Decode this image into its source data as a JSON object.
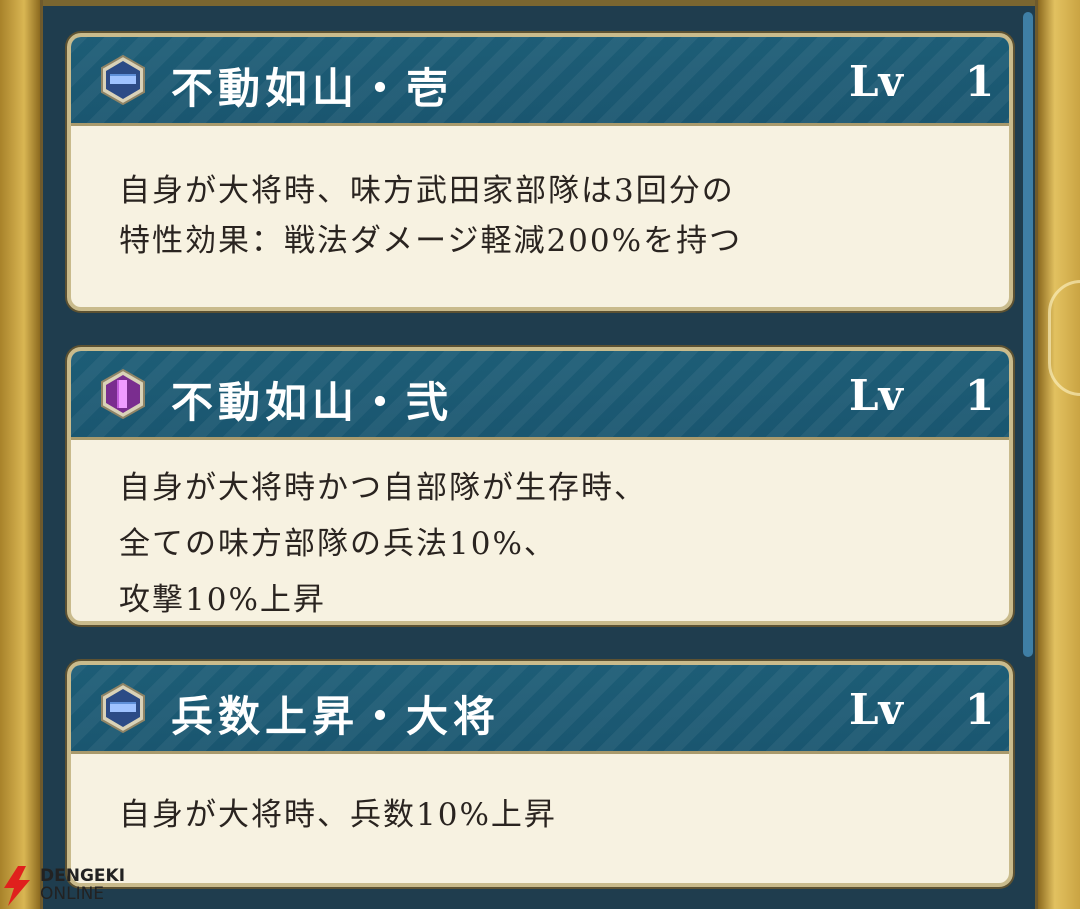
{
  "skills": [
    {
      "name": "不動如山・壱",
      "icon": "blue-hexagon-icon",
      "icon_color": "#4a7fc8",
      "lv_label": "Lv",
      "lv_value": "1",
      "lines": [
        "自身が大将時、味方武田家部隊は3回分の",
        "特性効果：戦法ダメージ軽減200%を持つ"
      ]
    },
    {
      "name": "不動如山・弐",
      "icon": "purple-hexagon-icon",
      "icon_color": "#b04bc7",
      "lv_label": "Lv",
      "lv_value": "1",
      "lines": [
        "自身が大将時かつ自部隊が生存時、",
        "全ての味方部隊の兵法10%、",
        "攻撃10%上昇"
      ]
    },
    {
      "name": "兵数上昇・大将",
      "icon": "blue-hexagon-icon",
      "icon_color": "#4a7fc8",
      "lv_label": "Lv",
      "lv_value": "1",
      "lines": [
        "自身が大将時、兵数10%上昇"
      ]
    }
  ],
  "watermark": {
    "line1": "DENGEKI",
    "line2": "ONLINE"
  },
  "colors": {
    "header_bg": "#1a5670",
    "card_bg": "#f7f2e1",
    "panel_bg": "#1f3d4e",
    "accent_gold": "#c9a23e",
    "scrollbar": "#3f7fa5"
  }
}
